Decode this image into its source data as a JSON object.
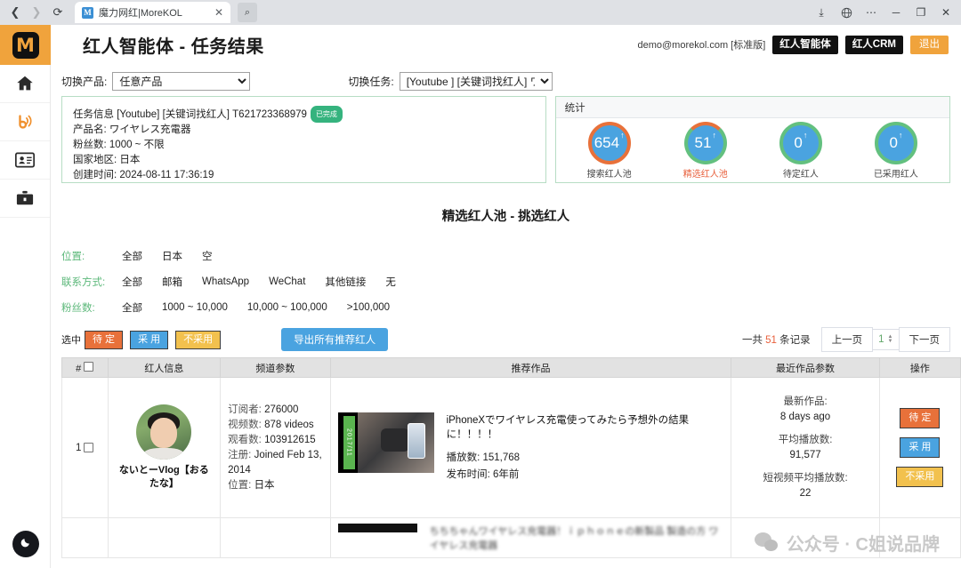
{
  "browser": {
    "back_icon": "back-arrow-icon",
    "forward_icon": "forward-arrow-icon",
    "reload_icon": "reload-icon",
    "tab_favicon_letter": "M",
    "tab_title": "魔力网红|MoreKOL",
    "tab_close": "✕",
    "tab_search_icon": "search-icon",
    "win_download": "⤓",
    "win_globe": "🌐",
    "win_more": "⋯",
    "win_minimize": "─",
    "win_maximize": "❐",
    "win_close": "✕"
  },
  "sidebar": {
    "logo_letter": "M",
    "items": [
      {
        "name": "home-icon"
      },
      {
        "name": "broadcast-icon"
      },
      {
        "name": "contact-card-icon"
      },
      {
        "name": "briefcase-icon"
      }
    ],
    "dark_mode_icon": "moon-icon"
  },
  "header": {
    "title": "红人智能体 - 任务结果",
    "user_email": "demo@morekol.com [标准版]",
    "buttons": [
      {
        "label": "红人智能体",
        "style": "dark"
      },
      {
        "label": "红人CRM",
        "style": "dark"
      },
      {
        "label": "退出",
        "style": "orange"
      }
    ]
  },
  "switch_bar": {
    "product_label": "切换产品:",
    "product_value": "任意产品",
    "task_label": "切换任务:",
    "task_value": "[Youtube ] [关键词找红人] ワイヤ"
  },
  "task_panel": {
    "title_prefix": "任务信息",
    "title": "任务信息 [Youtube] [关键词找红人] T621723368979",
    "status_badge": "已完成",
    "rows": [
      {
        "key": "产品名:",
        "value": "ワイヤレス充電器"
      },
      {
        "key": "粉丝数:",
        "value": "1000 ~ 不限"
      },
      {
        "key": "国家地区:",
        "value": "日本"
      },
      {
        "key": "创建时间:",
        "value": "2024-08-11 17:36:19"
      }
    ]
  },
  "stats_panel": {
    "header": "统计",
    "items": [
      {
        "value": "654",
        "arrow": "↑",
        "label": "搜索红人池",
        "ring": "#e8713a",
        "highlight": false
      },
      {
        "value": "51",
        "arrow": "↑",
        "label": "精选红人池",
        "ring": "#63c07f",
        "highlight": true
      },
      {
        "value": "0",
        "arrow": "↑",
        "label": "待定红人",
        "ring": "#63c07f",
        "highlight": false
      },
      {
        "value": "0",
        "arrow": "↑",
        "label": "已采用红人",
        "ring": "#63c07f",
        "highlight": false
      }
    ]
  },
  "section_title": "精选红人池 - 挑选红人",
  "filters": [
    {
      "key": "位置:",
      "options": [
        "全部",
        "日本",
        "空"
      ]
    },
    {
      "key": "联系方式:",
      "options": [
        "全部",
        "邮箱",
        "WhatsApp",
        "WeChat",
        "其他链接",
        "无"
      ]
    },
    {
      "key": "粉丝数:",
      "options": [
        "全部",
        "1000 ~ 10,000",
        "10,000 ~ 100,000",
        ">100,000"
      ]
    }
  ],
  "actions": {
    "selected_label": "选中",
    "pills": [
      {
        "label": "待 定",
        "kind": "pending"
      },
      {
        "label": "采 用",
        "kind": "adopt"
      },
      {
        "label": "不采用",
        "kind": "reject"
      }
    ],
    "export_label": "导出所有推荐红人"
  },
  "pager": {
    "total_prefix": "一共",
    "total_count": "51",
    "total_suffix": "条记录",
    "prev_label": "上一页",
    "page_value": "1",
    "next_label": "下一页"
  },
  "table": {
    "columns": [
      "#",
      "红人信息",
      "频道参数",
      "推荐作品",
      "最近作品参数",
      "操作"
    ],
    "rows": [
      {
        "index": "1",
        "kol_name": "ないとーVlog【おるたな】",
        "channel": [
          {
            "key": "订阅者:",
            "value": "276000"
          },
          {
            "key": "视频数:",
            "value": "878 videos"
          },
          {
            "key": "观看数:",
            "value": "103912615"
          },
          {
            "key": "注册:",
            "value": "Joined Feb 13, 2014"
          },
          {
            "key": "位置:",
            "value": "日本"
          }
        ],
        "work": {
          "thumb_date": "2017/11",
          "title": "iPhoneXでワイヤレス充電使ってみたら予想外の結果に！！！！",
          "meta": [
            {
              "key": "播放数:",
              "value": "151,768"
            },
            {
              "key": "发布时间:",
              "value": "6年前"
            }
          ]
        },
        "recent": [
          {
            "key": "最新作品:",
            "value": "8 days ago"
          },
          {
            "key": "平均播放数:",
            "value": "91,577"
          },
          {
            "key": "短视频平均播放数:",
            "value": "22"
          }
        ],
        "ops": [
          {
            "label": "待 定",
            "kind": "pending"
          },
          {
            "label": "采 用",
            "kind": "adopt"
          },
          {
            "label": "不采用",
            "kind": "reject"
          }
        ]
      }
    ]
  },
  "watermark": {
    "icon": "wechat-icon",
    "text": "公众号 · C姐说品牌"
  }
}
